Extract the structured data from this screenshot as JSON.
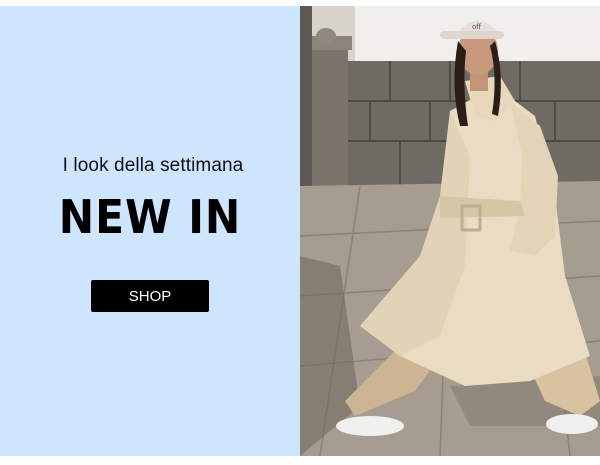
{
  "promo": {
    "subtitle": "I look della settimana",
    "headline": "NEW IN",
    "cta_label": "SHOP",
    "cap_text": "off"
  },
  "colors": {
    "panel_background": "#cde6fd",
    "button_background": "#000000",
    "button_text": "#ffffff"
  },
  "image": {
    "icon": "model-in-trench-coat-photo"
  }
}
